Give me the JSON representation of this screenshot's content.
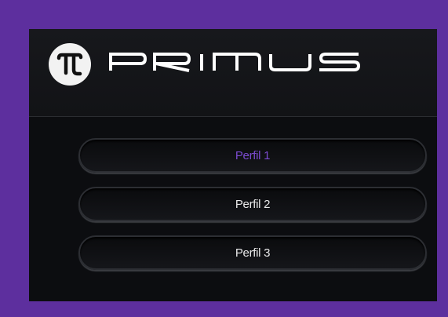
{
  "brand": {
    "logo_glyph": "π",
    "name": "PRIMUS"
  },
  "profiles": [
    {
      "label": "Perfil 1",
      "active": true
    },
    {
      "label": "Perfil 2",
      "active": false
    },
    {
      "label": "Perfil 3",
      "active": false
    }
  ],
  "colors": {
    "frame": "#5d2f9e",
    "panel": "#0e0f12",
    "active_text": "#7b4bd0",
    "text": "#e9e9ea"
  }
}
